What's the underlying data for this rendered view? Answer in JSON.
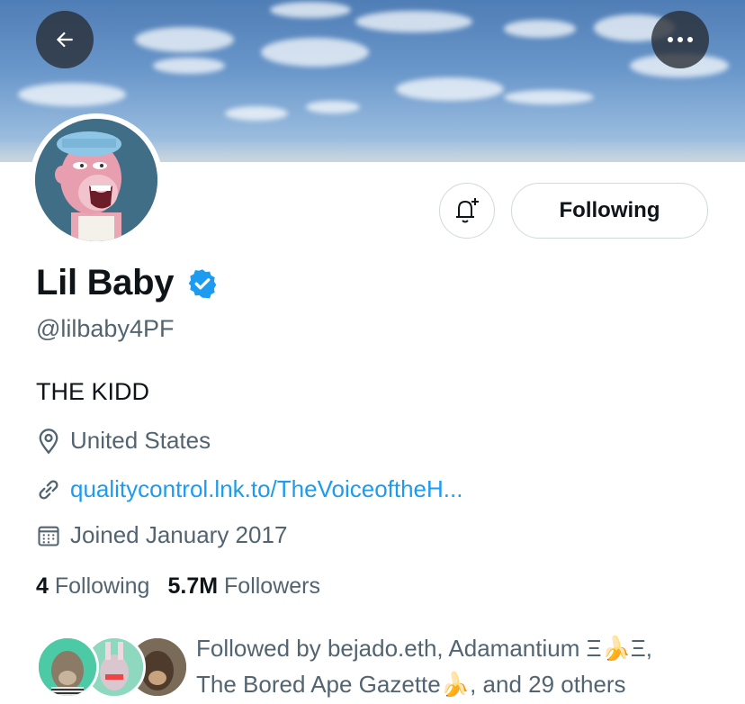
{
  "header": {
    "back_icon": "arrow-left-icon",
    "more_icon": "more-horizontal-icon"
  },
  "profile": {
    "display_name": "Lil Baby",
    "verified": true,
    "handle": "@lilbaby4PF",
    "bio": "THE KIDD",
    "location": "United States",
    "website": "qualitycontrol.lnk.to/TheVoiceoftheH...",
    "joined": "Joined January 2017"
  },
  "actions": {
    "notify_icon": "bell-plus-icon",
    "follow_label": "Following"
  },
  "stats": {
    "following_count": "4",
    "following_label": "Following",
    "followers_count": "5.7M",
    "followers_label": "Followers"
  },
  "followed_by": {
    "line1": "Followed by bejado.eth, Adamantium Ξ🍌Ξ,",
    "line2": "The Bored Ape Gazette🍌, and 29 others"
  },
  "colors": {
    "accent": "#1d9bf0",
    "secondary_text": "#536471",
    "primary_text": "#0f1419",
    "border": "#cfd9de"
  }
}
